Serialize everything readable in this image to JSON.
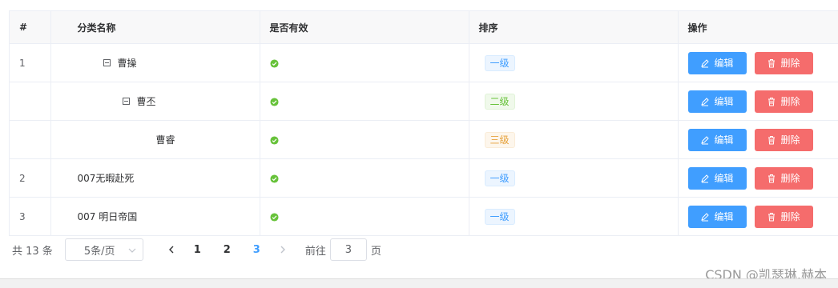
{
  "columns": [
    "#",
    "分类名称",
    "是否有效",
    "排序",
    "操作"
  ],
  "rows": [
    {
      "index": "1",
      "name": "曹操",
      "level": "一级",
      "level_class": "tag-l1",
      "expanded": true,
      "depth": 0
    },
    {
      "index": "",
      "name": "曹丕",
      "level": "二级",
      "level_class": "tag-l2",
      "expanded": true,
      "depth": 1
    },
    {
      "index": "",
      "name": "曹睿",
      "level": "三级",
      "level_class": "tag-l3",
      "expanded": false,
      "depth": 2
    },
    {
      "index": "2",
      "name": "007无暇赴死",
      "level": "一级",
      "level_class": "tag-l1",
      "expanded": false,
      "depth": 0
    },
    {
      "index": "3",
      "name": "007 明日帝国",
      "level": "一级",
      "level_class": "tag-l1",
      "expanded": false,
      "depth": 0
    }
  ],
  "actions": {
    "edit": "编辑",
    "delete": "删除"
  },
  "valid_color": "#67c23a",
  "pagination": {
    "total": "共 13 条",
    "page_size": "5条/页",
    "pages": [
      "1",
      "2",
      "3"
    ],
    "current_page": "3",
    "goto_prefix": "前往",
    "goto_value": "3",
    "goto_suffix": "页"
  },
  "watermark": "CSDN @凯瑟琳.赫本",
  "colors": {
    "primary": "#409eff",
    "danger": "#f56c6c",
    "success": "#67c23a",
    "warning": "#e6a23c"
  }
}
